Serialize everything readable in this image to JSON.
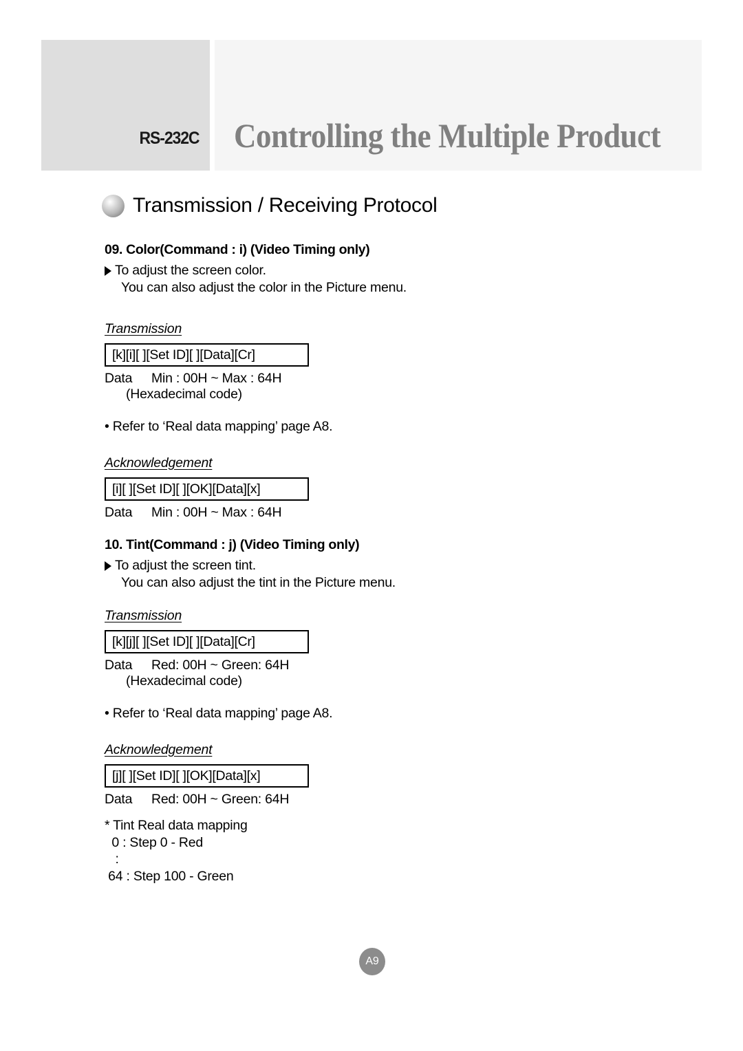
{
  "header": {
    "badge_label": "RS-232C",
    "title": "Controlling the Multiple Product"
  },
  "section": {
    "bullet_icon": "sphere-bullet-icon",
    "heading": "Transmission / Receiving Protocol"
  },
  "commands": [
    {
      "number_title": "09. Color(Command : i) (Video Timing only)",
      "purpose": "To adjust the screen color.",
      "purpose_extra": "You can also adjust the color in the Picture menu.",
      "transmission_label": "Transmission",
      "transmission_code": "[k][i][ ][Set ID][ ][Data][Cr]",
      "transmission_data_label": "Data",
      "transmission_data_value": "Min : 00H ~ Max : 64H",
      "hex_note": "(Hexadecimal code)",
      "refer_note": "• Refer to ‘Real data mapping’ page A8.",
      "ack_label": "Acknowledgement",
      "ack_code": "[i][ ][Set ID][ ][OK][Data][x]",
      "ack_data_label": "Data",
      "ack_data_value": "Min : 00H ~ Max : 64H"
    },
    {
      "number_title": "10. Tint(Command : j) (Video Timing only)",
      "purpose": "To adjust the screen tint.",
      "purpose_extra": "You can also adjust the tint in the Picture menu.",
      "transmission_label": "Transmission",
      "transmission_code": "[k][j][ ][Set ID][ ][Data][Cr]",
      "transmission_data_label": "Data",
      "transmission_data_value": "Red: 00H ~ Green: 64H",
      "hex_note": "(Hexadecimal code)",
      "refer_note": "• Refer to ‘Real data mapping’ page A8.",
      "ack_label": "Acknowledgement",
      "ack_code": "[j][ ][Set ID][ ][OK][Data][x]",
      "ack_data_label": "Data",
      "ack_data_value": "Red: 00H ~ Green: 64H"
    }
  ],
  "tint_mapping": {
    "title": "* Tint Real data mapping",
    "lines": [
      "  0 : Step 0 - Red",
      "   :",
      " 64 : Step 100 - Green"
    ]
  },
  "footer": {
    "page_number": "A9"
  },
  "colors": {
    "header_left_bg": "#dedede",
    "header_right_bg": "#f5f5f5",
    "title_text": "#808080",
    "badge_bg": "#8c8c8c",
    "body_text": "#000000"
  }
}
